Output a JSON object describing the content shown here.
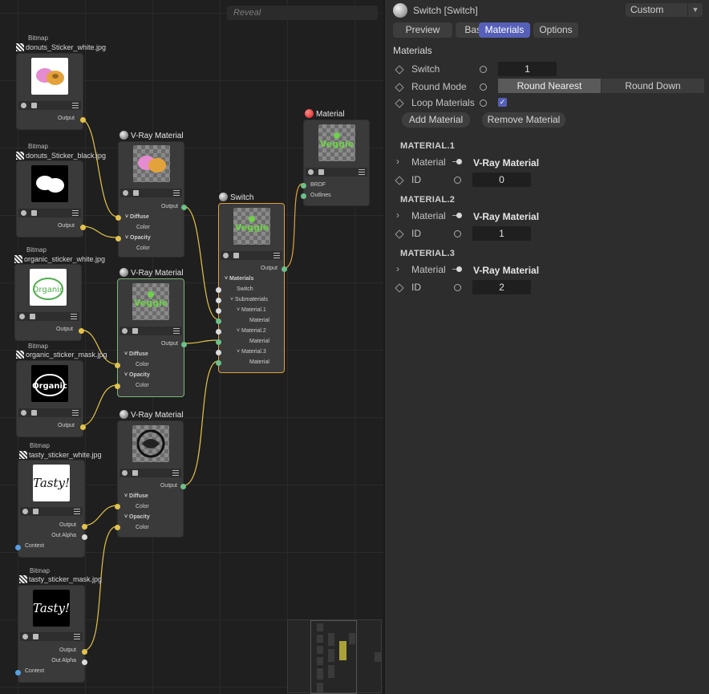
{
  "graph": {
    "reveal_placeholder": "Reveal",
    "bitmaps": [
      {
        "type": "Bitmap",
        "name": "donuts_Sticker_white.jpg",
        "output": "Output"
      },
      {
        "type": "Bitmap",
        "name": "donuts_Sticker_black.jpg",
        "output": "Output"
      },
      {
        "type": "Bitmap",
        "name": "organic_sticker_white.jpg",
        "output": "Output"
      },
      {
        "type": "Bitmap",
        "name": "organic_sticker_mask.jpg",
        "output": "Output"
      },
      {
        "type": "Bitmap",
        "name": "tasty_sticker_white.jpg",
        "output": "Output",
        "alpha": "Out Alpha",
        "context": "Context"
      },
      {
        "type": "Bitmap",
        "name": "tasty_sticker_mask.jpg",
        "output": "Output",
        "alpha": "Out Alpha",
        "context": "Context"
      }
    ],
    "thumb_text": {
      "organic": "Organic",
      "tasty": "Tasty!",
      "veggie": "Veggie"
    },
    "vray": {
      "title": "V-Ray Material",
      "output": "Output",
      "diffuse": "Diffuse",
      "opacity": "Opacity",
      "color": "Color"
    },
    "switch_node": {
      "title": "Switch",
      "output": "Output",
      "materials": "Materials",
      "switch": "Switch",
      "submaterials": "Submaterials",
      "items": [
        "Material.1",
        "Material.2",
        "Material.3"
      ],
      "sub": "Material"
    },
    "material_node": {
      "title": "Material",
      "brdf": "BRDF",
      "outlines": "Outlines"
    }
  },
  "panel": {
    "title": "Switch [Switch]",
    "preset": "Custom",
    "tabs": [
      "Preview",
      "Basic",
      "Materials",
      "Options"
    ],
    "active_tab": "Materials",
    "section": "Materials",
    "switch_label": "Switch",
    "switch_value": "1",
    "round_mode_label": "Round Mode",
    "round_nearest": "Round Nearest",
    "round_down": "Round Down",
    "loop_label": "Loop Materials",
    "loop_checked": true,
    "add_material": "Add Material",
    "remove_material": "Remove Material",
    "groups": [
      {
        "header": "MATERIAL.1",
        "material_label": "Material",
        "material_value": "V-Ray Material",
        "id_label": "ID",
        "id_value": "0"
      },
      {
        "header": "MATERIAL.2",
        "material_label": "Material",
        "material_value": "V-Ray Material",
        "id_label": "ID",
        "id_value": "1"
      },
      {
        "header": "MATERIAL.3",
        "material_label": "Material",
        "material_value": "V-Ray Material",
        "id_label": "ID",
        "id_value": "2"
      }
    ]
  },
  "colors": {
    "accent": "#5660b8",
    "wire": "#e2c24a",
    "wire_green": "#6cc08a",
    "selected_node": "#e0a040"
  }
}
